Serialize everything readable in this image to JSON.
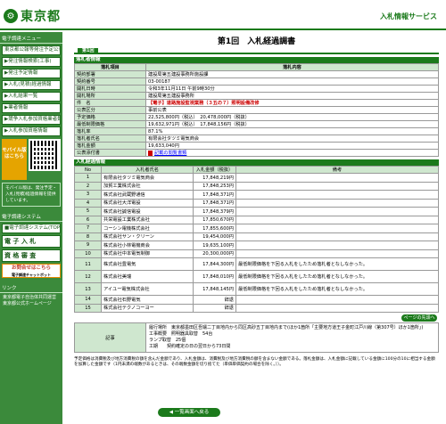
{
  "header": {
    "logo_text": "東京都",
    "logo_icon": "tokyo-emblem-icon",
    "service_label": "入札情報サービス"
  },
  "sidebar": {
    "menu_title": "電子調達メニュー",
    "items": [
      {
        "label": "東京都公報等発注予定公表"
      },
      {
        "label": "▶発注情報検索(工事)"
      },
      {
        "label": "▶発注予定情報"
      },
      {
        "label": "▶入札(見積)経過情報"
      },
      {
        "label": "▶入札結果一覧"
      },
      {
        "label": "▶業者情報"
      },
      {
        "label": "▶競争入札参加資格業者数"
      },
      {
        "label": "▶入札参加資格情報"
      }
    ],
    "mobile_label": "モバイル版はこちら",
    "mobile_note": "モバイル版は、発注予定・入札(見積)経過情報を提供しています。",
    "section2_title": "電子調達システム",
    "section2_items": [
      {
        "label": "■電子調達システム(TOP)"
      },
      {
        "label": "電 子 入 札"
      },
      {
        "label": "資 格 審 査"
      }
    ],
    "ticket_label": "お問合せはこちら",
    "ticket_sub": "電子調達チャットボット",
    "links_title": "リンク",
    "links": [
      "東京都電子自治体共同運営",
      "東京都公式ホームページ"
    ]
  },
  "main": {
    "title": "第1回　入札経過調書",
    "tab_label": "第1回",
    "info_section": "落札者情報",
    "info_header": [
      "落札項目",
      "落札内容"
    ],
    "info_rows": [
      {
        "k": "契約部署",
        "v": "建設局第五建設事務所施設課"
      },
      {
        "k": "契約番号",
        "v": "03-00187"
      },
      {
        "k": "開札日時",
        "v": "令和3年11月11日 午前9時30分"
      },
      {
        "k": "開札場所",
        "v": "建設局第五建設事務所"
      },
      {
        "k": "件　名",
        "v": "【電子】道路施設監視業務（３五の７）照明設備改修"
      },
      {
        "k": "公表区分",
        "v": "事前公表"
      },
      {
        "k": "予定価格",
        "v": "22,525,800円（税込）　20,478,000円（税抜）"
      },
      {
        "k": "最低制限価格",
        "v": "19,632,971円（税込）　17,848,156円（税抜）"
      },
      {
        "k": "落札率",
        "v": "87.1%"
      },
      {
        "k": "落札者氏名",
        "v": "有限会社タツミ電気商会"
      },
      {
        "k": "落札金額",
        "v": "19,633,040円"
      },
      {
        "k": "公表添付書",
        "v": "記載の閲覧書類"
      }
    ],
    "result_section": "入札経過情報",
    "result_header": {
      "no": "No",
      "name": "入札者氏名",
      "amount": "入札金額（税抜）",
      "remark": "備考"
    },
    "results": [
      {
        "no": "1",
        "name": "有限会社タツミ電気商会",
        "amount": "17,848,219円",
        "remark": ""
      },
      {
        "no": "2",
        "name": "加賀工業株式会社",
        "amount": "17,848,253円",
        "remark": ""
      },
      {
        "no": "3",
        "name": "株式会社武蔵野通信",
        "amount": "17,848,371円",
        "remark": ""
      },
      {
        "no": "4",
        "name": "株式会社大洋電設",
        "amount": "17,848,371円",
        "remark": ""
      },
      {
        "no": "5",
        "name": "株式会社誠信電設",
        "amount": "17,848,379円",
        "remark": ""
      },
      {
        "no": "6",
        "name": "共栄電設工業株式会社",
        "amount": "17,850,670円",
        "remark": ""
      },
      {
        "no": "7",
        "name": "コーシン電機株式会社",
        "amount": "17,855,600円",
        "remark": ""
      },
      {
        "no": "8",
        "name": "株式会社サン・クリーン",
        "amount": "19,454,000円",
        "remark": ""
      },
      {
        "no": "9",
        "name": "株式会社小林電機商会",
        "amount": "19,635,100円",
        "remark": ""
      },
      {
        "no": "10",
        "name": "株式会社中本電気制御",
        "amount": "20,300,000円",
        "remark": ""
      },
      {
        "no": "11",
        "name": "株式会社豊電気",
        "amount": "17,844,300円",
        "remark": "最低制限価格を下回る入札をしたため落札者となしなかった。"
      },
      {
        "no": "12",
        "name": "株式会社美瑞",
        "amount": "17,848,010円",
        "remark": "最低制限価格を下回る入札をしたため落札者となしなかった。"
      },
      {
        "no": "13",
        "name": "アイユー電気株式会社",
        "amount": "17,848,145円",
        "remark": "最低制限価格を下回る入札をしたため落札者となしなかった。"
      },
      {
        "no": "14",
        "name": "株式会社石野電気",
        "amount": "辞退",
        "remark": ""
      },
      {
        "no": "15",
        "name": "株式会社テクノコーヨー",
        "amount": "辞退",
        "remark": ""
      }
    ],
    "back_to_top": "ページの先頭へ",
    "memo_label": "記事",
    "memo_text": "履行場所　東京都墨田区吾嬬二丁目地内から同区高砂五丁目地内まで(ほか1箇所「主要地方道王子金町江戸川線（第307号）ほか1箇所」)\n工事概要　照明器具取替　54台\nランプ取替　25個\n工期　　契約確定の日の翌日から73日間",
    "notes": "予定価格は消費税及び地方消費税の額を含んだ金額であり、入札金額は、消費税及び地方消費税の額を含まない金額である。落札金額は、入札金額に記載している金額に100分の10に相当する金額を加算した金額です（1円未満の端数があるときは、その端数金額を切り捨てた（単価単価契約の場合を除く。））。",
    "back_button": "◀ 一覧画面へ戻る"
  }
}
